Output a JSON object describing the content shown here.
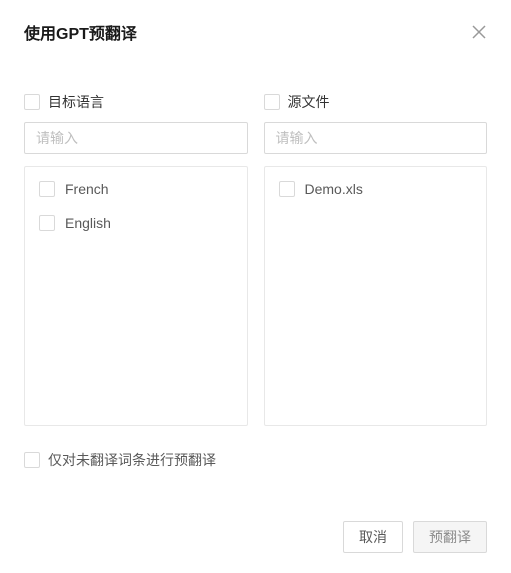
{
  "header": {
    "title": "使用GPT预翻译"
  },
  "left": {
    "label": "目标语言",
    "placeholder": "请输入",
    "items": [
      "French",
      "English"
    ]
  },
  "right": {
    "label": "源文件",
    "placeholder": "请输入",
    "items": [
      "Demo.xls"
    ]
  },
  "option": {
    "label": "仅对未翻译词条进行预翻译"
  },
  "buttons": {
    "cancel": "取消",
    "confirm": "预翻译"
  }
}
